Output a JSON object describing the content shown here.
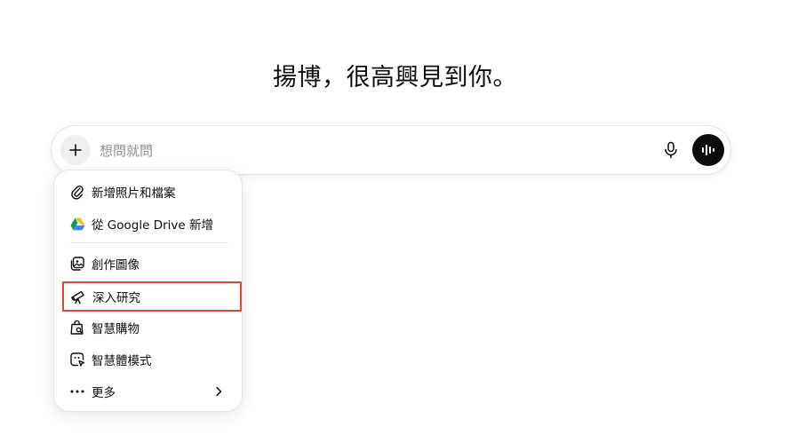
{
  "greeting": "揚博，很高興見到你。",
  "composer": {
    "placeholder": "想問就問",
    "value": ""
  },
  "menu": {
    "items": [
      {
        "label": "新增照片和檔案",
        "icon": "paperclip-icon"
      },
      {
        "label": "從 Google Drive 新增",
        "icon": "google-drive-icon"
      },
      {
        "label": "創作圖像",
        "icon": "image-create-icon"
      },
      {
        "label": "深入研究",
        "icon": "telescope-icon",
        "highlighted": true
      },
      {
        "label": "智慧購物",
        "icon": "shopping-bag-icon"
      },
      {
        "label": "智慧體模式",
        "icon": "agent-cursor-icon"
      },
      {
        "label": "更多",
        "icon": "more-dots-icon"
      }
    ]
  },
  "colors": {
    "highlight_border": "#e0492b",
    "voice_button_bg": "#0d0d0d",
    "plus_button_bg": "#efefef"
  }
}
